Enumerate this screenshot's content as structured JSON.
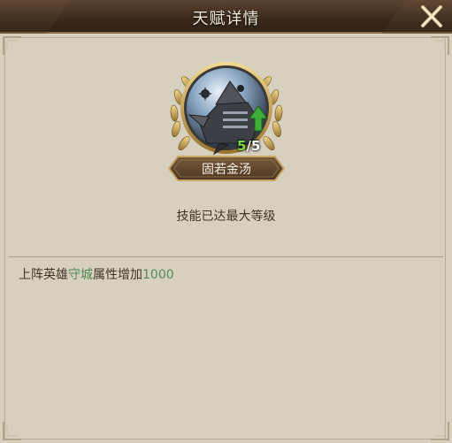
{
  "dialog": {
    "title": "天赋详情"
  },
  "skill": {
    "name": "固若金汤",
    "level_current": "5",
    "level_sep": "/",
    "level_max": "5",
    "status": "技能已达最大等级"
  },
  "description": {
    "prefix": "上阵英雄",
    "attribute": "守城",
    "middle": "属性增加",
    "value": "1000"
  },
  "colors": {
    "highlight": "#4e8a55",
    "level_green": "#7cdc4a"
  },
  "icons": [
    "close-icon",
    "laurel-wreath-icon",
    "upgrade-arrow-icon",
    "corner-ornament-icon"
  ]
}
